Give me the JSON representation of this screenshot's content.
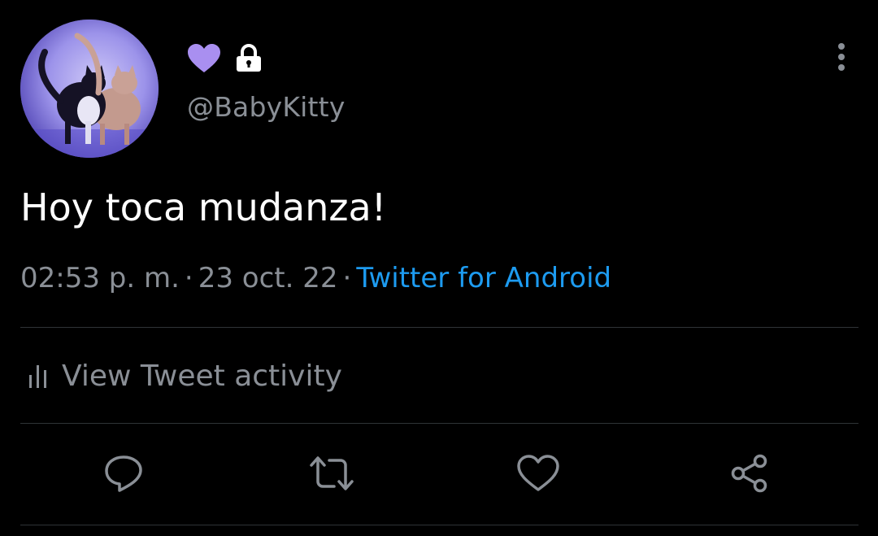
{
  "user": {
    "avatar_icon": "cats-avatar",
    "name_icons": [
      "purple-heart-icon",
      "lock-icon"
    ],
    "handle": "@BabyKitty"
  },
  "tweet": {
    "text": "Hoy toca mudanza!",
    "time": "02:53 p. m.",
    "date": "23 oct. 22",
    "separator": "·",
    "source": "Twitter for Android"
  },
  "activity": {
    "label": "View Tweet activity",
    "icon": "bar-chart-icon"
  },
  "actions": [
    {
      "name": "reply",
      "icon": "reply-icon"
    },
    {
      "name": "retweet",
      "icon": "retweet-icon"
    },
    {
      "name": "like",
      "icon": "heart-icon"
    },
    {
      "name": "share",
      "icon": "share-icon"
    }
  ],
  "colors": {
    "background": "#000000",
    "text_primary": "#ffffff",
    "text_secondary": "#8a8f96",
    "link": "#1d9bf0",
    "heart_emoji": "#a98ff0",
    "divider": "#2f3336"
  }
}
